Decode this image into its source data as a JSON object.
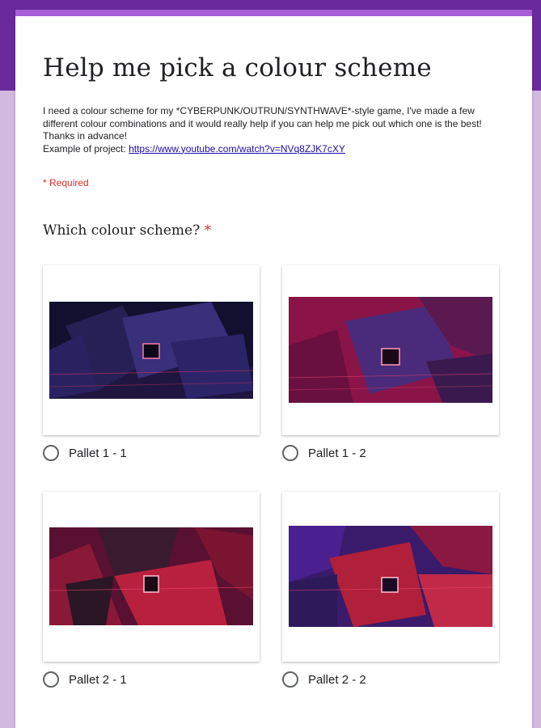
{
  "form": {
    "title": "Help me pick a colour scheme",
    "description_line1": "I need a colour scheme for my *CYBERPUNK/OUTRUN/SYNTHWAVE*-style game, I've made a few different colour combinations and it would really help if you can help me pick out which one is the best! Thanks in advance!",
    "description_line2_prefix": "Example of project: ",
    "description_link": "https://www.youtube.com/watch?v=NVq8ZJK7cXY",
    "required_note": "* Required"
  },
  "question": {
    "title": "Which colour scheme?",
    "required_star": "*",
    "options": [
      {
        "label": "Pallet 1 - 1",
        "selected": false,
        "palette": {
          "sky": "#12102e",
          "panel": "#3a2f7a",
          "panel_dark": "#262055",
          "grid": "#d0305a"
        }
      },
      {
        "label": "Pallet 1 - 2",
        "selected": false,
        "palette": {
          "sky": "#8a1448",
          "panel": "#4a2a7a",
          "panel_dark": "#5a1a50",
          "grid": "#e0406a"
        }
      },
      {
        "label": "Pallet 2 - 1",
        "selected": false,
        "palette": {
          "sky": "#5a1030",
          "panel": "#b8203e",
          "panel_dark": "#3a1a2e",
          "grid": "#ff4a70"
        }
      },
      {
        "label": "Pallet 2 - 2",
        "selected": false,
        "palette": {
          "sky": "#3a1a6a",
          "panel": "#b0203a",
          "panel_dark": "#4a2090",
          "grid": "#ff4a70"
        }
      }
    ]
  },
  "colors": {
    "header_band": "#6a2a9e",
    "card_accent": "#a65ed6",
    "page_background": "#d1b9e0",
    "required_red": "#d93025",
    "link": "#1a0dab"
  }
}
